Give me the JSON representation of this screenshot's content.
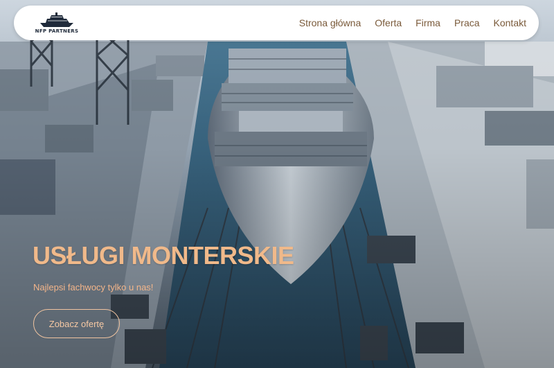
{
  "brand": {
    "logo_text": "NFP PARTNERS",
    "logo_icon": "ship-icon"
  },
  "nav": {
    "items": [
      {
        "label": "Strona główna"
      },
      {
        "label": "Oferta"
      },
      {
        "label": "Firma"
      },
      {
        "label": "Praca"
      },
      {
        "label": "Kontakt"
      }
    ]
  },
  "hero": {
    "title": "USŁUGI MONTERSKIE",
    "subtitle": "Najlepsi fachwocy tylko u nas!",
    "cta_label": "Zobacz ofertę",
    "image": "shipyard-aerial-ship-illustration"
  },
  "colors": {
    "accent": "#f0b98a",
    "nav_text": "#7a5a3a",
    "navbar_bg": "#ffffff"
  }
}
